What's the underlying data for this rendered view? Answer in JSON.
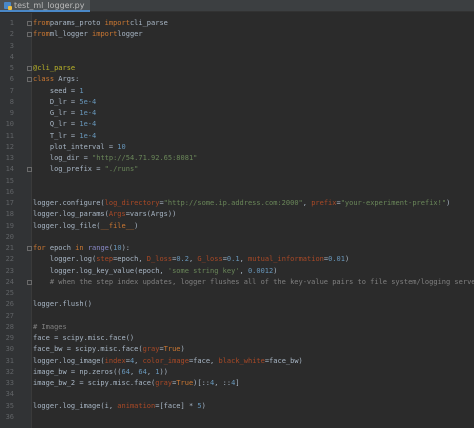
{
  "tab": {
    "label": "test_ml_logger.py",
    "icon": "python-file-icon"
  },
  "colors": {
    "background": "#2b2b2b",
    "keyword": "#cc7832",
    "string": "#6a8759",
    "number": "#6897bb",
    "comment": "#808080",
    "decorator": "#bbb529",
    "param": "#aa4926"
  },
  "lines": [
    {
      "n": "1",
      "seg": [
        [
          "kw",
          "from"
        ],
        [
          "",
          "params_proto "
        ],
        [
          "kw",
          "import"
        ],
        [
          "",
          "cli_parse"
        ]
      ]
    },
    {
      "n": "2",
      "seg": [
        [
          "kw",
          "from"
        ],
        [
          "",
          "ml_logger "
        ],
        [
          "kw",
          "import"
        ],
        [
          "",
          "logger"
        ]
      ]
    },
    {
      "n": "3",
      "seg": []
    },
    {
      "n": "4",
      "seg": []
    },
    {
      "n": "5",
      "seg": [
        [
          "dec",
          "@cli_parse"
        ]
      ]
    },
    {
      "n": "6",
      "seg": [
        [
          "kw",
          "class"
        ],
        [
          "",
          " Args:"
        ]
      ]
    },
    {
      "n": "7",
      "seg": [
        [
          "",
          "    seed = "
        ],
        [
          "num",
          "1"
        ]
      ]
    },
    {
      "n": "8",
      "seg": [
        [
          "",
          "    D_lr = "
        ],
        [
          "num",
          "5e-4"
        ]
      ]
    },
    {
      "n": "9",
      "seg": [
        [
          "",
          "    G_lr = "
        ],
        [
          "num",
          "1e-4"
        ]
      ]
    },
    {
      "n": "10",
      "seg": [
        [
          "",
          "    Q_lr = "
        ],
        [
          "num",
          "1e-4"
        ]
      ]
    },
    {
      "n": "11",
      "seg": [
        [
          "",
          "    T_lr = "
        ],
        [
          "num",
          "1e-4"
        ]
      ]
    },
    {
      "n": "12",
      "seg": [
        [
          "",
          "    plot_interval = "
        ],
        [
          "num",
          "10"
        ]
      ]
    },
    {
      "n": "13",
      "seg": [
        [
          "",
          "    log_dir = "
        ],
        [
          "str",
          "\"http://54.71.92.65:8081\""
        ]
      ]
    },
    {
      "n": "14",
      "seg": [
        [
          "",
          "    log_prefix = "
        ],
        [
          "str",
          "\"./runs\""
        ]
      ]
    },
    {
      "n": "15",
      "seg": []
    },
    {
      "n": "16",
      "seg": []
    },
    {
      "n": "17",
      "seg": [
        [
          "",
          "logger.configure("
        ],
        [
          "param",
          "log_directory"
        ],
        [
          "",
          "="
        ],
        [
          "str",
          "\"http://some.ip.address.com:2000\""
        ],
        [
          "",
          ", "
        ],
        [
          "param",
          "prefix"
        ],
        [
          "",
          "="
        ],
        [
          "str",
          "\"your-experiment-prefix!\""
        ],
        [
          "",
          ")"
        ]
      ]
    },
    {
      "n": "18",
      "seg": [
        [
          "",
          "logger.log_params("
        ],
        [
          "param",
          "Args"
        ],
        [
          "",
          "=vars(Args))"
        ]
      ]
    },
    {
      "n": "19",
      "seg": [
        [
          "",
          "logger.log_file("
        ],
        [
          "kw",
          "__file__"
        ],
        [
          "",
          ")"
        ]
      ]
    },
    {
      "n": "20",
      "seg": []
    },
    {
      "n": "21",
      "seg": [
        [
          "kw",
          "for"
        ],
        [
          "",
          " epoch "
        ],
        [
          "kw",
          "in"
        ],
        [
          "",
          " "
        ],
        [
          "builtin",
          "range"
        ],
        [
          "",
          "("
        ],
        [
          "num",
          "10"
        ],
        [
          "",
          "):"
        ]
      ]
    },
    {
      "n": "22",
      "seg": [
        [
          "",
          "    logger.log("
        ],
        [
          "param",
          "step"
        ],
        [
          "",
          "=epoch, "
        ],
        [
          "param",
          "D_loss"
        ],
        [
          "",
          "="
        ],
        [
          "num",
          "0.2"
        ],
        [
          "",
          ", "
        ],
        [
          "param",
          "G_loss"
        ],
        [
          "",
          "="
        ],
        [
          "num",
          "0.1"
        ],
        [
          "",
          ", "
        ],
        [
          "param",
          "mutual_information"
        ],
        [
          "",
          "="
        ],
        [
          "num",
          "0.01"
        ],
        [
          "",
          ")"
        ]
      ]
    },
    {
      "n": "23",
      "seg": [
        [
          "",
          "    logger.log_key_value(epoch, "
        ],
        [
          "str",
          "'some string key'"
        ],
        [
          "",
          ", "
        ],
        [
          "num",
          "0.0012"
        ],
        [
          "",
          ")"
        ]
      ]
    },
    {
      "n": "24",
      "seg": [
        [
          "cmt",
          "    # when the step index updates, logger flushes all of the key-value pairs to file system/logging server"
        ]
      ]
    },
    {
      "n": "25",
      "seg": []
    },
    {
      "n": "26",
      "seg": [
        [
          "",
          "logger.flush()"
        ]
      ]
    },
    {
      "n": "27",
      "seg": []
    },
    {
      "n": "28",
      "seg": [
        [
          "cmt",
          "# Images"
        ]
      ]
    },
    {
      "n": "29",
      "seg": [
        [
          "",
          "face = scipy.misc.face()"
        ]
      ]
    },
    {
      "n": "30",
      "seg": [
        [
          "",
          "face_bw = scipy.misc.face("
        ],
        [
          "param",
          "gray"
        ],
        [
          "",
          "="
        ],
        [
          "kw",
          "True"
        ],
        [
          "",
          ")"
        ]
      ]
    },
    {
      "n": "31",
      "seg": [
        [
          "",
          "logger.log_image("
        ],
        [
          "param",
          "index"
        ],
        [
          "",
          "="
        ],
        [
          "num",
          "4"
        ],
        [
          "",
          ", "
        ],
        [
          "param",
          "color_image"
        ],
        [
          "",
          "=face, "
        ],
        [
          "param",
          "black_white"
        ],
        [
          "",
          "=face_bw)"
        ]
      ]
    },
    {
      "n": "32",
      "seg": [
        [
          "",
          "image_bw = np.zeros(("
        ],
        [
          "num",
          "64"
        ],
        [
          "",
          ", "
        ],
        [
          "num",
          "64"
        ],
        [
          "",
          ", "
        ],
        [
          "num",
          "1"
        ],
        [
          "",
          "))"
        ]
      ]
    },
    {
      "n": "33",
      "seg": [
        [
          "",
          "image_bw_2 = scipy.misc.face("
        ],
        [
          "param",
          "gray"
        ],
        [
          "",
          "="
        ],
        [
          "kw",
          "True"
        ],
        [
          "",
          ")[::"
        ],
        [
          "num",
          "4"
        ],
        [
          "",
          ", ::"
        ],
        [
          "num",
          "4"
        ],
        [
          "",
          "]"
        ]
      ]
    },
    {
      "n": "34",
      "seg": []
    },
    {
      "n": "35",
      "seg": [
        [
          "",
          "logger.log_image(i, "
        ],
        [
          "param",
          "animation"
        ],
        [
          "",
          "=[face] * "
        ],
        [
          "num",
          "5"
        ],
        [
          "",
          ")"
        ]
      ]
    },
    {
      "n": "36",
      "seg": []
    }
  ]
}
